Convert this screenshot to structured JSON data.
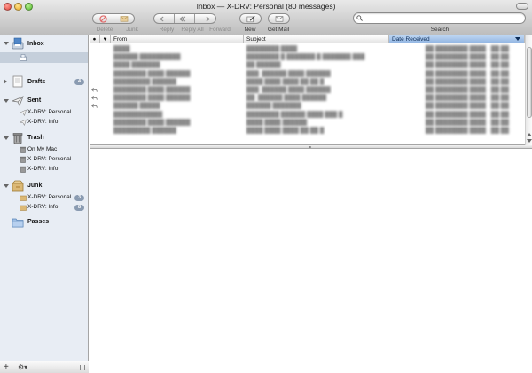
{
  "window": {
    "title": "Inbox — X-DRV: Personal (80 messages)"
  },
  "toolbar": {
    "delete_label": "Delete",
    "junk_label": "Junk",
    "reply_label": "Reply",
    "reply_all_label": "Reply All",
    "forward_label": "Forward",
    "new_label": "New",
    "get_mail_label": "Get Mail",
    "search_label": "Search",
    "search_value": ""
  },
  "sidebar": {
    "inbox": {
      "label": "Inbox"
    },
    "drafts": {
      "label": "Drafts",
      "badge": "4"
    },
    "sent": {
      "label": "Sent",
      "accounts": [
        {
          "label": "X-DRV: Personal"
        },
        {
          "label": "X-DRV: Info"
        }
      ]
    },
    "trash": {
      "label": "Trash",
      "accounts": [
        {
          "label": "On My Mac"
        },
        {
          "label": "X-DRV: Personal"
        },
        {
          "label": "X-DRV: Info"
        }
      ]
    },
    "junk": {
      "label": "Junk",
      "accounts": [
        {
          "label": "X-DRV: Personal",
          "badge": "3"
        },
        {
          "label": "X-DRV: Info",
          "badge": "8"
        }
      ]
    },
    "passes": {
      "label": "Passes"
    }
  },
  "message_list": {
    "columns": {
      "from": "From",
      "subject": "Subject",
      "date_received": "Date Received"
    },
    "rows": [
      {
        "from": "████",
        "subject": "████████ ████",
        "date": "██ ████████ ████ ·  ██:██",
        "replied": false
      },
      {
        "from": "██████ ██████████",
        "subject": "████████ █ ███████ █ ███████ ███",
        "date": "██ ████████ ████ ·  ██:██",
        "replied": false
      },
      {
        "from": "████ ███████",
        "subject": "██ ██████",
        "date": "██ ████████ ████ ·  ██:██",
        "replied": false
      },
      {
        "from": "████████ ████ ██████",
        "subject": "███: ██████ ████ ██████",
        "date": "██ ████████ ████ ·  ██:██",
        "replied": false
      },
      {
        "from": "█████████ ██████",
        "subject": "████ ████ ████ ██:██ █",
        "date": "██ ████████ ████ ·  ██:██",
        "replied": false
      },
      {
        "from": "████████ ████ ██████",
        "subject": "███: ██████ ████ ██████",
        "date": "██ ████████ ████ ·  ██:██",
        "replied": true
      },
      {
        "from": "████████ ████ ██████",
        "subject": "██: ██████ ████ ██████",
        "date": "██ ████████ ████ ·  ██:██",
        "replied": true
      },
      {
        "from": "██████ █████",
        "subject": "██████ ███████",
        "date": "██ ████████ ████ ·  ██:██",
        "replied": true
      },
      {
        "from": "████████████",
        "subject": "████████ ██████ ████ ███ █",
        "date": "██ ████████ ████ ·  ██:██",
        "replied": false
      },
      {
        "from": "████████ ████ ██████",
        "subject": "████ ████ ██████",
        "date": "██ ████████ ████ ·  ██:██",
        "replied": false
      },
      {
        "from": "█████████ ██████",
        "subject": "████ ████ ████ ██:██ █",
        "date": "██ ████████ ████ ·  ██:██",
        "replied": false
      }
    ]
  },
  "colors": {
    "sidebar_bg": "#e8edf4",
    "selected_row": "#c5cfdb",
    "sort_header": "#a7c5ea",
    "badge": "#8a9bb1"
  }
}
